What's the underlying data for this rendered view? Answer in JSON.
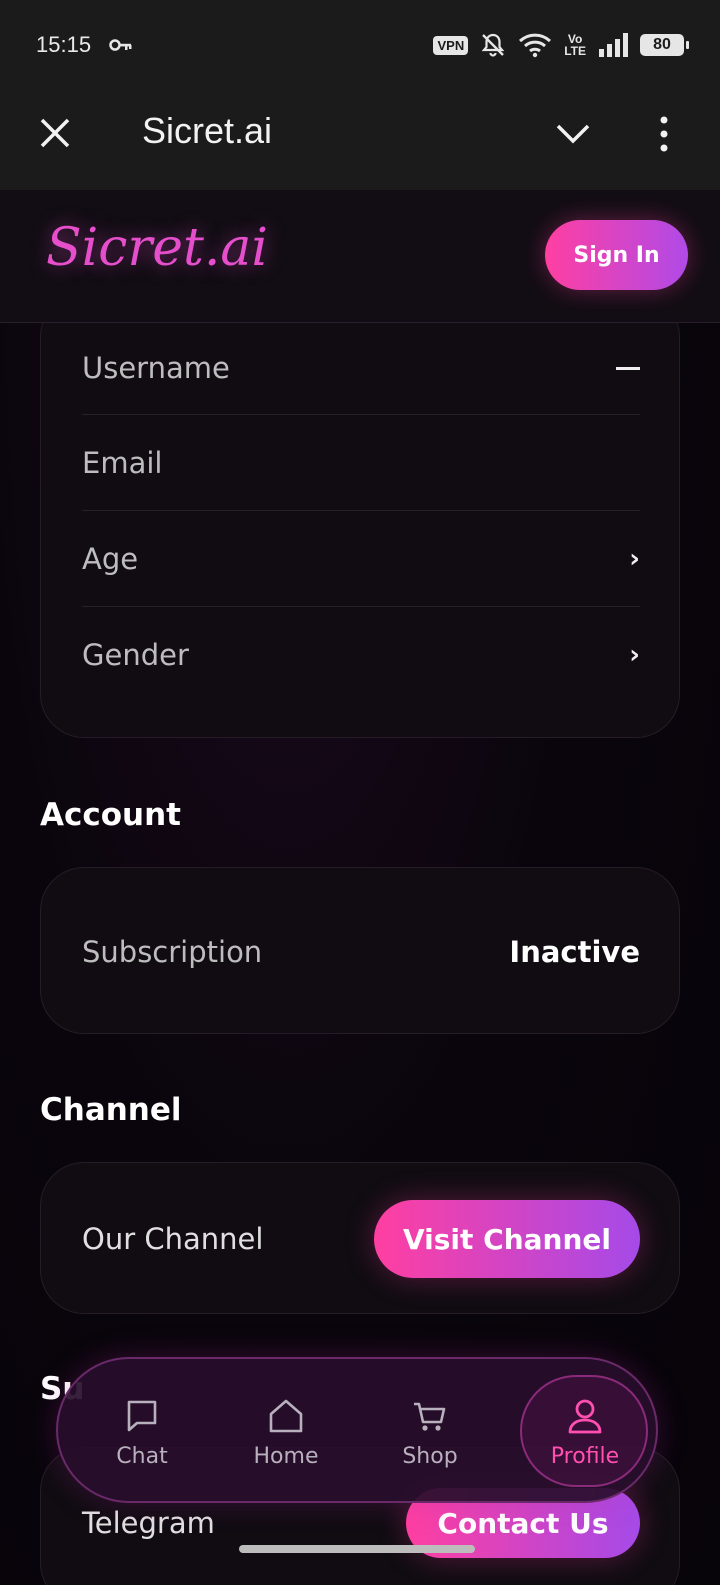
{
  "status_bar": {
    "time": "15:15",
    "vpn": "VPN",
    "volte_top": "Vo",
    "volte_bottom": "LTE",
    "battery": "80"
  },
  "browser": {
    "title": "Sicret.ai"
  },
  "site_header": {
    "logo": "Sicret.ai",
    "sign_in": "Sign In"
  },
  "profile_card": {
    "rows": [
      {
        "label": "Username"
      },
      {
        "label": "Email"
      },
      {
        "label": "Age"
      },
      {
        "label": "Gender"
      }
    ]
  },
  "account": {
    "title": "Account",
    "subscription_label": "Subscription",
    "subscription_value": "Inactive"
  },
  "channel": {
    "title": "Channel",
    "label": "Our Channel",
    "button": "Visit Channel"
  },
  "support": {
    "title": "Su",
    "telegram_label": "Telegram",
    "button": "Contact Us"
  },
  "bottom_nav": {
    "items": [
      {
        "label": "Chat",
        "icon": "chat-icon"
      },
      {
        "label": "Home",
        "icon": "home-icon"
      },
      {
        "label": "Shop",
        "icon": "cart-icon"
      },
      {
        "label": "Profile",
        "icon": "user-icon",
        "active": true
      }
    ]
  },
  "colors": {
    "accent_pink": "#ff3fa1",
    "accent_purple": "#a54ae8",
    "background": "#07040a"
  }
}
